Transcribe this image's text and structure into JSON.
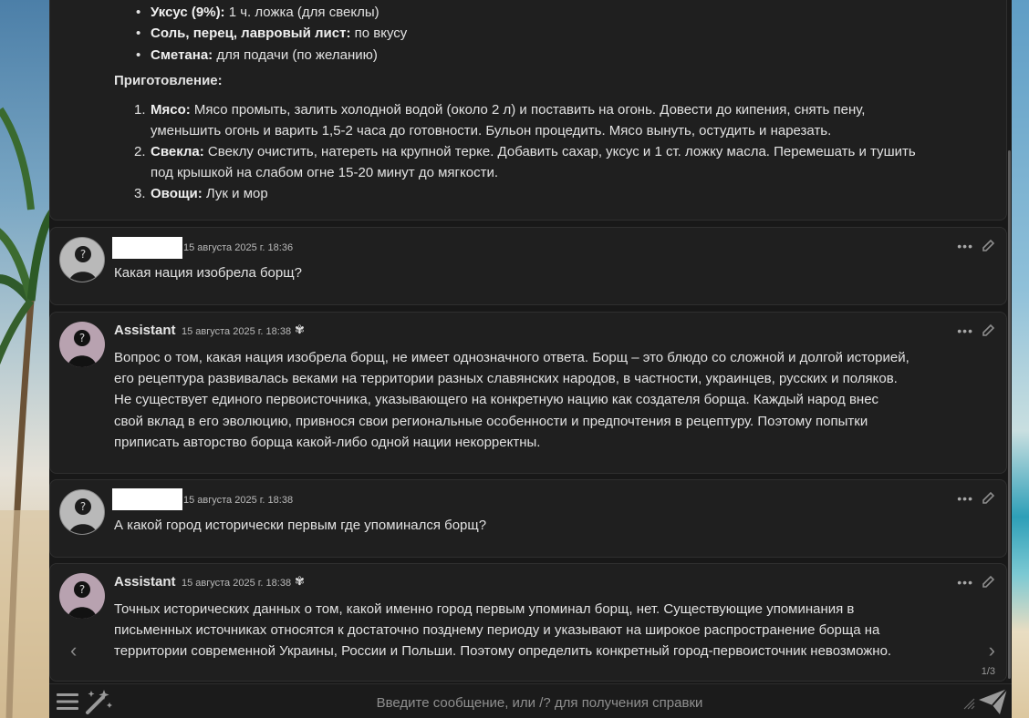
{
  "recipe": {
    "ingredients": [
      {
        "bold": "Уксус (9%):",
        "text": " 1 ч. ложка (для свеклы)"
      },
      {
        "bold": "Соль, перец, лавровый лист:",
        "text": " по вкусу"
      },
      {
        "bold": "Сметана:",
        "text": " для подачи (по желанию)"
      }
    ],
    "heading": "Приготовление:",
    "steps": [
      {
        "num": "1.",
        "bold": "Мясо:",
        "line1": " Мясо промыть, залить холодной водой (около 2 л) и поставить на огонь. Довести до кипения, снять пену,",
        "line2": "уменьшить огонь и варить 1,5-2 часа до готовности. Бульон процедить. Мясо вынуть, остудить и нарезать."
      },
      {
        "num": "2.",
        "bold": "Свекла:",
        "line1": " Свеклу очистить, натереть на крупной терке. Добавить сахар, уксус и 1 ст. ложку масла. Перемешать и тушить",
        "line2": "под крышкой на слабом огне 15-20 минут до мягкости."
      },
      {
        "num": "3.",
        "bold": "Овощи:",
        "line1": " Лук и мор",
        "line2": ""
      }
    ]
  },
  "messages": [
    {
      "role": "user",
      "time": "15 августа 2025 г. 18:36",
      "lines": [
        "Какая нация изобрела борщ?"
      ]
    },
    {
      "role": "assistant",
      "name": "Assistant",
      "time": "15 августа 2025 г. 18:38",
      "lines": [
        "Вопрос о том, какая нация изобрела борщ, не имеет однозначного ответа. Борщ – это блюдо со сложной и долгой историей,",
        "его рецептура развивалась веками на территории разных славянских народов, в частности, украинцев, русских и поляков.",
        "Не существует единого первоисточника, указывающего на конкретную нацию как создателя борща. Каждый народ внес",
        "свой вклад в его эволюцию, привнося свои региональные особенности и предпочтения в рецептуру. Поэтому попытки",
        "приписать авторство борща какой-либо одной нации некорректны."
      ]
    },
    {
      "role": "user",
      "time": "15 августа 2025 г. 18:38",
      "lines": [
        "А какой город исторически первым где упоминался борщ?"
      ]
    },
    {
      "role": "assistant",
      "name": "Assistant",
      "time": "15 августа 2025 г. 18:38",
      "lines": [
        "Точных исторических данных о том, какой именно город первым упоминал борщ, нет. Существующие упоминания в",
        "письменных источниках относятся к достаточно позднему периоду и указывают на широкое распространение борща на",
        "территории современной Украины, России и Польши. Поэтому определить конкретный город-первоисточник невозможно."
      ]
    }
  ],
  "swipe": {
    "prev": "‹",
    "next": "›",
    "counter": "1/3"
  },
  "icons": {
    "more": "•••",
    "bot": "bot-icon",
    "edit": "pencil-icon"
  },
  "composer": {
    "placeholder": "Введите сообщение, или /? для получения справки"
  }
}
